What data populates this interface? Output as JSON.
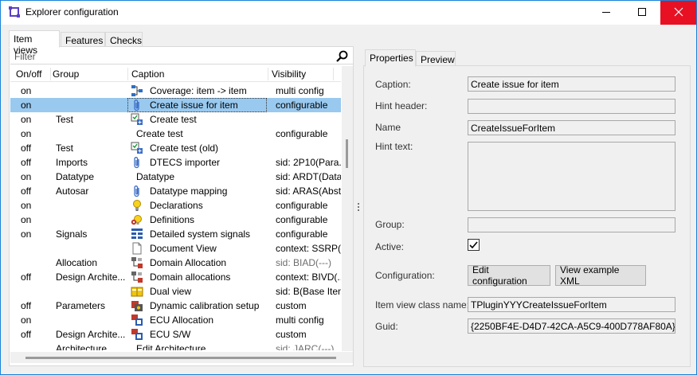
{
  "window": {
    "title": "Explorer configuration",
    "colors": {
      "accent": "#1883d7",
      "close_bg": "#e81123",
      "selection": "#99c9ef"
    }
  },
  "left_tabs": [
    "Item views",
    "Features",
    "Checks"
  ],
  "filter": {
    "placeholder": "Filter",
    "value": ""
  },
  "columns": [
    "On/off",
    "Group",
    "Caption",
    "Visibility"
  ],
  "rows": [
    {
      "onoff": "on",
      "group": "",
      "icon": "flow-icon",
      "caption": "Coverage: item -> item",
      "visibility": "multi config",
      "vis_grey": false
    },
    {
      "onoff": "on",
      "group": "",
      "icon": "paperclip-icon",
      "caption": "Create issue for item",
      "visibility": "configurable",
      "vis_grey": false,
      "selected": true
    },
    {
      "onoff": "on",
      "group": "Test",
      "icon": "test-icon",
      "caption": "Create test",
      "visibility": "",
      "vis_grey": false
    },
    {
      "onoff": "on",
      "group": "",
      "icon": "",
      "caption": "Create test",
      "visibility": "configurable",
      "vis_grey": false
    },
    {
      "onoff": "off",
      "group": "Test",
      "icon": "test-icon",
      "caption": "Create test (old)",
      "visibility": "",
      "vis_grey": false
    },
    {
      "onoff": "off",
      "group": "Imports",
      "icon": "paperclip-icon",
      "caption": "DTECS importer",
      "visibility": "sid: 2P10(Para...",
      "vis_grey": false
    },
    {
      "onoff": "on",
      "group": "Datatype",
      "icon": "",
      "caption": "Datatype",
      "visibility": "sid: ARDT(Data...",
      "vis_grey": false
    },
    {
      "onoff": "off",
      "group": "Autosar",
      "icon": "paperclip-icon",
      "caption": "Datatype mapping",
      "visibility": "sid: ARAS(Abst...",
      "vis_grey": false
    },
    {
      "onoff": "on",
      "group": "",
      "icon": "bulb-icon",
      "caption": "Declarations",
      "visibility": "configurable",
      "vis_grey": false
    },
    {
      "onoff": "on",
      "group": "",
      "icon": "gear-bulb-icon",
      "caption": "Definitions",
      "visibility": "configurable",
      "vis_grey": false
    },
    {
      "onoff": "on",
      "group": "Signals",
      "icon": "signal-tree-icon",
      "caption": "Detailed system signals",
      "visibility": "configurable",
      "vis_grey": false
    },
    {
      "onoff": "",
      "group": "",
      "icon": "document-icon",
      "caption": "Document View",
      "visibility": "context: SSRP(...",
      "vis_grey": false
    },
    {
      "onoff": "",
      "group": "Allocation",
      "icon": "alloc-icon",
      "caption": "Domain Allocation",
      "visibility": "sid: BIAD(---)",
      "vis_grey": true
    },
    {
      "onoff": "off",
      "group": "Design Archite...",
      "icon": "alloc-icon",
      "caption": "Domain allocations",
      "visibility": "context: BIVD(...",
      "vis_grey": false
    },
    {
      "onoff": "",
      "group": "",
      "icon": "dual-view-icon",
      "caption": "Dual view",
      "visibility": "sid: B(Base Item",
      "vis_grey": false
    },
    {
      "onoff": "off",
      "group": "Parameters",
      "icon": "calibration-icon",
      "caption": "Dynamic calibration setup",
      "visibility": "custom",
      "vis_grey": false
    },
    {
      "onoff": "on",
      "group": "",
      "icon": "ecu-icon",
      "caption": "ECU Allocation",
      "visibility": "multi config",
      "vis_grey": false
    },
    {
      "onoff": "off",
      "group": "Design Archite...",
      "icon": "ecu-icon",
      "caption": "ECU S/W",
      "visibility": "custom",
      "vis_grey": false
    },
    {
      "onoff": "",
      "group": "Architecture",
      "icon": "",
      "caption": "Edit Architecture",
      "visibility": "sid: JARC(---)",
      "vis_grey": true
    }
  ],
  "right_tabs": [
    "Properties",
    "Preview"
  ],
  "properties": {
    "caption_label": "Caption:",
    "caption_value": "Create issue for item",
    "hint_header_label": "Hint header:",
    "hint_header_value": "",
    "name_label": "Name",
    "name_value": "CreateIssueForItem",
    "hint_text_label": "Hint text:",
    "hint_text_value": "",
    "group_label": "Group:",
    "group_value": "",
    "active_label": "Active:",
    "active_checked": true,
    "configuration_label": "Configuration:",
    "edit_config_button": "Edit configuration",
    "view_xml_button": "View example XML",
    "class_name_label": "Item view class name:",
    "class_name_value": "TPluginYYYCreateIssueForItem",
    "guid_label": "Guid:",
    "guid_value": "{2250BF4E-D4D7-42CA-A5C9-400D778AF80A}"
  }
}
